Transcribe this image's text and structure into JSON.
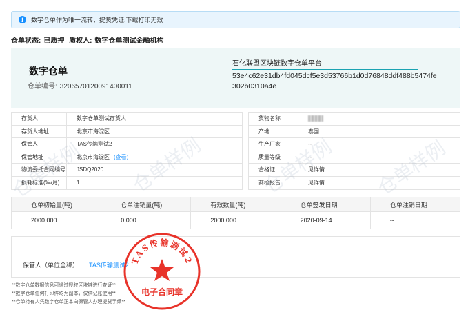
{
  "notice": {
    "icon": "info-icon",
    "text": "数字仓单作为唯一流转，提货凭证,下载打印无效"
  },
  "status": {
    "state_label": "仓单状态:",
    "state_value": "已质押",
    "pledgee_label": "质权人:",
    "pledgee_value": "数字仓单测试金融机构"
  },
  "receipt": {
    "title": "数字仓单",
    "code_label": "仓单编号:",
    "code_value": "3206570120091400011",
    "platform": "石化联盟区块链数字仓单平台",
    "hash": "53e4c62e31db4fd045dcf5e3d53766b1d0d76848ddf488b5474fe302b0310a4e"
  },
  "left_fields": [
    {
      "key": "存货人",
      "value": "数字仓单测试存货人"
    },
    {
      "key": "存货人地址",
      "value": "北京市海淀区"
    },
    {
      "key": "保管人",
      "value": "TAS传输测试2"
    },
    {
      "key": "保管地址",
      "value": "北京市海淀区",
      "link": "(查看)"
    },
    {
      "key": "物流委托合同编号",
      "value": "JSDQ2020"
    },
    {
      "key": "损耗标准(‰/月)",
      "value": "1"
    }
  ],
  "right_fields": [
    {
      "key": "货物名称",
      "value": ""
    },
    {
      "key": "产地",
      "value": "泰国"
    },
    {
      "key": "生产厂家",
      "value": "--"
    },
    {
      "key": "质量等级",
      "value": "--"
    },
    {
      "key": "合格证",
      "value": "见详情"
    },
    {
      "key": "商检报告",
      "value": "见详情"
    }
  ],
  "quantity_table": {
    "headers": [
      "仓单初始量(吨)",
      "仓单注销量(吨)",
      "有效数量(吨)",
      "仓单签发日期",
      "仓单注销日期"
    ],
    "values": [
      "2000.000",
      "0.000",
      "2000.000",
      "2020-09-14",
      "--"
    ]
  },
  "keeper": {
    "label": "保管人（单位全称）:",
    "value": "TAS传输测试2"
  },
  "notes": [
    "**数字仓单数据信息可通过授权区块链进行查证**",
    "**数字仓单任何打印件均为副本，仅供记账使用**",
    "**仓单持有人凭数字仓单正本向保管人办理提货手续**"
  ],
  "watermark": "仓单样例",
  "seal": {
    "ring_text": "TAS传输测试2",
    "bottom_text": "电子合同章",
    "color": "#e8332a"
  }
}
